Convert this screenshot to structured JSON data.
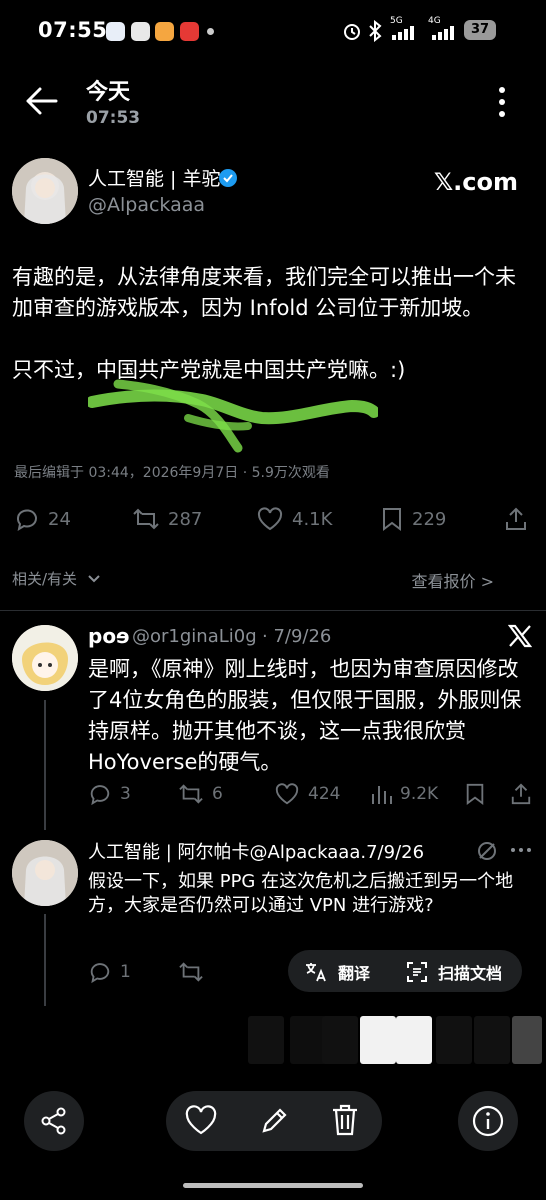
{
  "status_bar": {
    "time": "07:55",
    "battery": "37",
    "signal1": "5G",
    "signal2": "4G"
  },
  "header": {
    "title": "今天",
    "subtitle": "07:53"
  },
  "post": {
    "author_name": "人工智能 | 羊驼",
    "author_handle": "@Alpackaaa",
    "source_brand": "𝕏.com",
    "text": "有趣的是，从法律角度来看，我们完全可以推出一个未加审查的游戏版本，因为 Infold 公司位于新加坡。\n\n只不过，中国共产党就是中国共产党嘛。:)",
    "meta": "最后编辑于 03:44，2026年9月7日 · 5.9万次观看",
    "stats": {
      "replies": "24",
      "reposts": "287",
      "likes": "4.1K",
      "bookmarks": "229"
    },
    "related_label": "相关/有关",
    "quotes_label": "查看报价 >"
  },
  "reply1": {
    "author_name": "poɘ",
    "author_handle": "@or1ginaLi0g",
    "date": "· 7/9/26",
    "text": "是啊，《原神》刚上线时，也因为审查原因修改了4位女角色的服装，但仅限于国服，外服则保持原样。抛开其他不谈，这一点我很欣赏HoYoverse的硬气。",
    "stats": {
      "replies": "3",
      "reposts": "6",
      "likes": "424",
      "views": "9.2K"
    }
  },
  "reply2": {
    "author_line": "人工智能 | 阿尔帕卡@Alpackaaa.7/9/26",
    "text": "假设一下，如果 PPG 在这次危机之后搬迁到另一个地方，大家是否仍然可以通过 VPN 进行游戏?",
    "stats": {
      "replies": "1"
    }
  },
  "overlay": {
    "translate_label": "翻译",
    "scan_label": "扫描文档"
  },
  "colors": {
    "background": "#000000",
    "verified": "#1d9bf0",
    "scribble": "#7ee04a"
  }
}
